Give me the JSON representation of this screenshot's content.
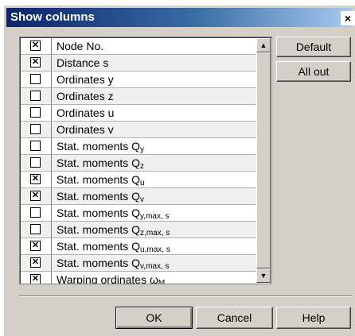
{
  "dialog": {
    "title": "Show columns",
    "close_glyph": "×"
  },
  "columns": [
    {
      "label": "Node No.",
      "sub": "",
      "checked": true
    },
    {
      "label": "Distance s",
      "sub": "",
      "checked": true
    },
    {
      "label": "Ordinates y",
      "sub": "",
      "checked": false
    },
    {
      "label": "Ordinates z",
      "sub": "",
      "checked": false
    },
    {
      "label": "Ordinates u",
      "sub": "",
      "checked": false
    },
    {
      "label": "Ordinates v",
      "sub": "",
      "checked": false
    },
    {
      "label": "Stat. moments Q",
      "sub": "y",
      "checked": false
    },
    {
      "label": "Stat. moments Q",
      "sub": "z",
      "checked": false
    },
    {
      "label": "Stat. moments Q",
      "sub": "u",
      "checked": true
    },
    {
      "label": "Stat. moments Q",
      "sub": "v",
      "checked": true
    },
    {
      "label": "Stat. moments Q",
      "sub": "y,max, s",
      "checked": false
    },
    {
      "label": "Stat. moments Q",
      "sub": "z,max, s",
      "checked": false
    },
    {
      "label": "Stat. moments Q",
      "sub": "u,max, s",
      "checked": true
    },
    {
      "label": "Stat. moments Q",
      "sub": "v,max, s",
      "checked": true
    },
    {
      "label": "Warping ordinates ω",
      "sub": "M",
      "checked": true
    }
  ],
  "checkbox_mark": "✕",
  "scrollbar": {
    "up_glyph": "▲",
    "down_glyph": "▼"
  },
  "buttons": {
    "default_label": "Default",
    "all_out_label": "All out",
    "ok_label": "OK",
    "cancel_label": "Cancel",
    "help_label": "Help"
  }
}
